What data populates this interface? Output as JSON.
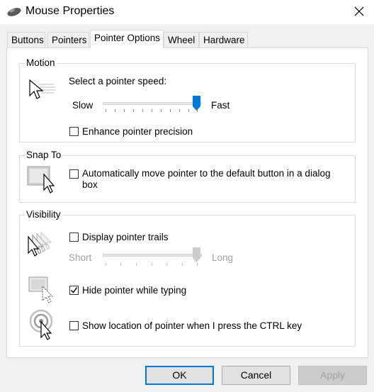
{
  "window": {
    "title": "Mouse Properties"
  },
  "tabs": [
    {
      "label": "Buttons"
    },
    {
      "label": "Pointers"
    },
    {
      "label": "Pointer Options"
    },
    {
      "label": "Wheel"
    },
    {
      "label": "Hardware"
    }
  ],
  "motion": {
    "label": "Motion",
    "speed_label": "Select a pointer speed:",
    "slow": "Slow",
    "fast": "Fast",
    "speed_value": 1.0,
    "precision_label": "Enhance pointer precision",
    "precision_checked": false
  },
  "snap": {
    "label": "Snap To",
    "option_line1": "Automatically move pointer to the default button in a dialog",
    "option_line2": "box",
    "checked": false
  },
  "visibility": {
    "label": "Visibility",
    "trails_label": "Display pointer trails",
    "trails_checked": false,
    "short": "Short",
    "long": "Long",
    "trails_value": 1.0,
    "hide_label": "Hide pointer while typing",
    "hide_checked": true,
    "ctrl_label": "Show location of pointer when I press the CTRL key",
    "ctrl_checked": false
  },
  "buttons": {
    "ok": "OK",
    "cancel": "Cancel",
    "apply": "Apply"
  },
  "colors": {
    "accent": "#0078d7"
  },
  "icons": [
    "mouse-icon",
    "close-icon",
    "pointer-speed-icon",
    "snap-to-icon",
    "pointer-trails-icon",
    "hide-pointer-icon",
    "ctrl-location-icon",
    "checkmark-icon"
  ]
}
